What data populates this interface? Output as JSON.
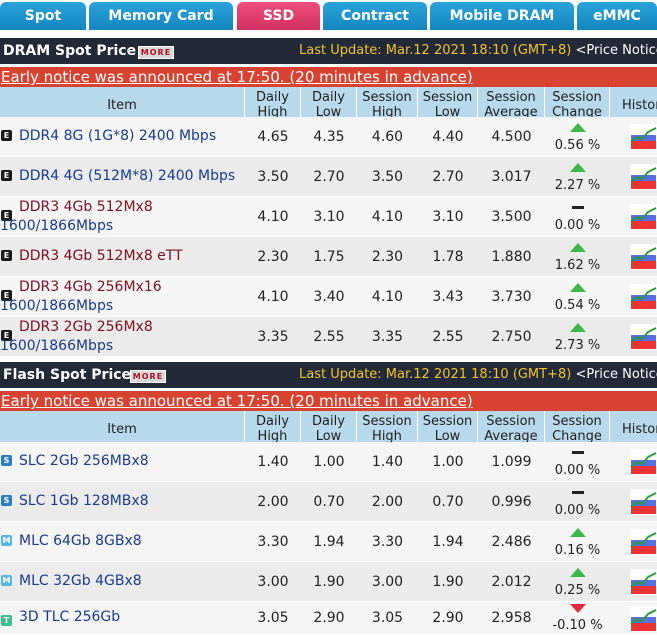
{
  "tabs": [
    {
      "label": "Spot"
    },
    {
      "label": "Memory Card"
    },
    {
      "label": "SSD"
    },
    {
      "label": "Contract"
    },
    {
      "label": "Mobile DRAM"
    },
    {
      "label": "eMMC"
    }
  ],
  "dram": {
    "title": "DRAM Spot Price",
    "more": "MORE",
    "last_update": "Last Update: Mar.12 2021 18:10 (GMT+8)",
    "price_notice": "<Price Notice:",
    "notice": "Early notice was announced at 17:50. (20 minutes in advance)",
    "columns": [
      "Item",
      "Daily\nHigh",
      "Daily\nLow",
      "Session\nHigh",
      "Session\nLow",
      "Session\nAverage",
      "Session\nChange",
      "Histor"
    ],
    "rows": [
      {
        "name": "DDR4 8G (1G*8) 2400 Mbps",
        "name2": "",
        "dh": "4.65",
        "dl": "4.35",
        "sh": "4.60",
        "sl": "4.40",
        "sa": "4.500",
        "change": "0.56 %",
        "dir": "up"
      },
      {
        "name": "DDR4 4G (512M*8) 2400 Mbps",
        "name2": "",
        "dh": "3.50",
        "dl": "2.70",
        "sh": "3.50",
        "sl": "2.70",
        "sa": "3.017",
        "change": "2.27 %",
        "dir": "up"
      },
      {
        "name": "DDR3 4Gb 512Mx8",
        "name2": "1600/1866Mbps",
        "dh": "4.10",
        "dl": "3.10",
        "sh": "4.10",
        "sl": "3.10",
        "sa": "3.500",
        "change": "0.00 %",
        "dir": "flat"
      },
      {
        "name": "DDR3 4Gb 512Mx8 eTT",
        "name2": "",
        "dh": "2.30",
        "dl": "1.75",
        "sh": "2.30",
        "sl": "1.78",
        "sa": "1.880",
        "change": "1.62 %",
        "dir": "up"
      },
      {
        "name": "DDR3 4Gb 256Mx16",
        "name2": "1600/1866Mbps",
        "dh": "4.10",
        "dl": "3.40",
        "sh": "4.10",
        "sl": "3.43",
        "sa": "3.730",
        "change": "0.54 %",
        "dir": "up"
      },
      {
        "name": "DDR3 2Gb 256Mx8",
        "name2": "1600/1866Mbps",
        "dh": "3.35",
        "dl": "2.55",
        "sh": "3.35",
        "sl": "2.55",
        "sa": "2.750",
        "change": "2.73 %",
        "dir": "up"
      }
    ]
  },
  "flash": {
    "title": "Flash Spot Price",
    "more": "MORE",
    "last_update": "Last Update: Mar.12 2021 18:10 (GMT+8)",
    "price_notice": "<Price Notice:",
    "notice": "Early notice was announced at 17:50. (20 minutes in advance)",
    "columns": [
      "Item",
      "Daily\nHigh",
      "Daily\nLow",
      "Session\nHigh",
      "Session\nLow",
      "Session\nAverage",
      "Session\nChange",
      "Histor"
    ],
    "rows": [
      {
        "name": "SLC 2Gb 256MBx8",
        "icon": "S",
        "dh": "1.40",
        "dl": "1.00",
        "sh": "1.40",
        "sl": "1.00",
        "sa": "1.099",
        "change": "0.00 %",
        "dir": "flat"
      },
      {
        "name": "SLC 1Gb 128MBx8",
        "icon": "S",
        "dh": "2.00",
        "dl": "0.70",
        "sh": "2.00",
        "sl": "0.70",
        "sa": "0.996",
        "change": "0.00 %",
        "dir": "flat"
      },
      {
        "name": "MLC 64Gb 8GBx8",
        "icon": "M",
        "dh": "3.30",
        "dl": "1.94",
        "sh": "3.30",
        "sl": "1.94",
        "sa": "2.486",
        "change": "0.16 %",
        "dir": "up"
      },
      {
        "name": "MLC 32Gb 4GBx8",
        "icon": "M",
        "dh": "3.00",
        "dl": "1.90",
        "sh": "3.00",
        "sl": "1.90",
        "sa": "2.012",
        "change": "0.25 %",
        "dir": "up"
      },
      {
        "name": "3D TLC 256Gb",
        "icon": "T",
        "dh": "3.05",
        "dl": "2.90",
        "sh": "3.05",
        "sl": "2.90",
        "sa": "2.958",
        "change": "-0.10 %",
        "dir": "down"
      }
    ]
  }
}
